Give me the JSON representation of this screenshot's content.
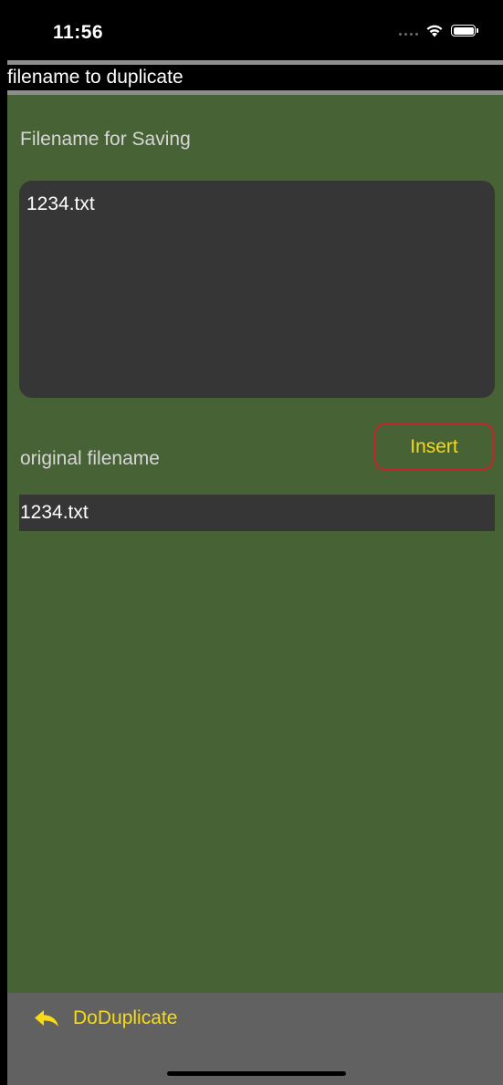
{
  "status": {
    "time": "11:56"
  },
  "nav": {
    "title": "filename to duplicate"
  },
  "form": {
    "saving_label": "Filename for Saving",
    "saving_value": "1234.txt",
    "insert_label": "Insert",
    "original_label": "original filename",
    "original_value": "1234.txt"
  },
  "toolbar": {
    "action_label": "DoDuplicate",
    "action_icon": "reply-arrow-icon"
  },
  "colors": {
    "background": "#476234",
    "field": "#363636",
    "accent": "#f8da15",
    "button_border": "#c4262c",
    "toolbar": "#616161"
  }
}
